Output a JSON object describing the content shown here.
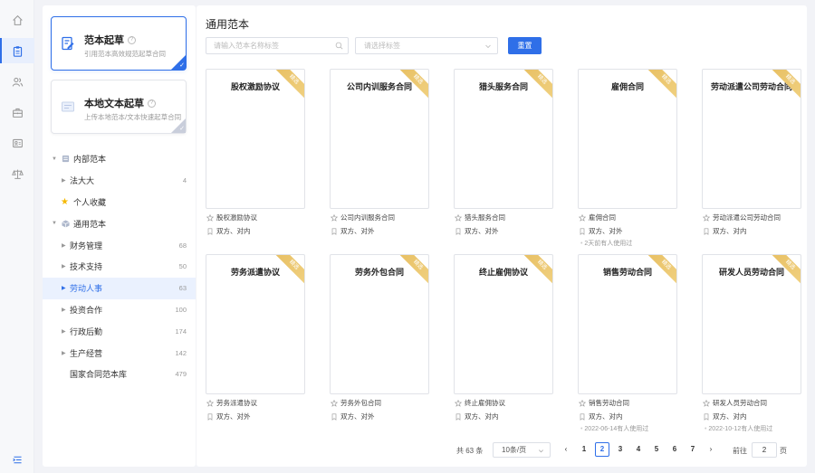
{
  "sidebar_rail": {
    "icons": [
      "home-icon",
      "clipboard-icon",
      "users-icon",
      "briefcase-icon",
      "id-card-icon",
      "scale-icon"
    ],
    "active_index": 1,
    "bottom_icon": "collapse-menu-icon"
  },
  "draft_cards": [
    {
      "title": "范本起草",
      "subtitle": "引用范本高效规范起草合同",
      "selected": true
    },
    {
      "title": "本地文本起草",
      "subtitle": "上传本地范本/文本快速起草合同",
      "selected": false
    }
  ],
  "tree": [
    {
      "label": "内部范本",
      "count": "",
      "level": 0,
      "expanded": true,
      "icon": "folder-icon"
    },
    {
      "label": "法大大",
      "count": "4",
      "level": 1,
      "expanded": false
    },
    {
      "label": "个人收藏",
      "count": "",
      "level": 1,
      "icon": "star-icon"
    },
    {
      "label": "通用范本",
      "count": "",
      "level": 0,
      "expanded": true,
      "icon": "cube-icon"
    },
    {
      "label": "财务管理",
      "count": "68",
      "level": 1,
      "expanded": false
    },
    {
      "label": "技术支持",
      "count": "50",
      "level": 1,
      "expanded": false
    },
    {
      "label": "劳动人事",
      "count": "63",
      "level": 1,
      "expanded": false,
      "active": true
    },
    {
      "label": "投资合作",
      "count": "100",
      "level": 1,
      "expanded": false
    },
    {
      "label": "行政后勤",
      "count": "174",
      "level": 1,
      "expanded": false
    },
    {
      "label": "生产经营",
      "count": "142",
      "level": 1,
      "expanded": false
    },
    {
      "label": "国家合同范本库",
      "count": "479",
      "level": 1,
      "noarrow": true
    }
  ],
  "main": {
    "title": "通用范本",
    "search_placeholder": "请输入范本名称标签",
    "tag_placeholder": "请选择标签",
    "reset_label": "重置",
    "ribbon_label": "精选"
  },
  "templates": [
    {
      "name": "股权激励协议",
      "parties": "双方、对内",
      "used": ""
    },
    {
      "name": "公司内训服务合同",
      "parties": "双方、对外",
      "used": ""
    },
    {
      "name": "猎头服务合同",
      "parties": "双方、对外",
      "used": ""
    },
    {
      "name": "雇佣合同",
      "parties": "双方、对外",
      "used": "2天前有人使用过"
    },
    {
      "name": "劳动派遣公司劳动合同",
      "parties": "双方、对内",
      "used": ""
    },
    {
      "name": "劳务派遣协议",
      "parties": "双方、对外",
      "used": ""
    },
    {
      "name": "劳务外包合同",
      "parties": "双方、对外",
      "used": ""
    },
    {
      "name": "终止雇佣协议",
      "parties": "双方、对内",
      "used": ""
    },
    {
      "name": "销售劳动合同",
      "parties": "双方、对内",
      "used": "2022-06-14有人使用过"
    },
    {
      "name": "研发人员劳动合同",
      "parties": "双方、对内",
      "used": "2022-10-12有人使用过"
    }
  ],
  "pagination": {
    "total_label": "共 63 条",
    "page_size": "10条/页",
    "pages": [
      "1",
      "2",
      "3",
      "4",
      "5",
      "6",
      "7"
    ],
    "current": "2",
    "goto_prefix": "前往",
    "goto_value": "2",
    "goto_suffix": "页"
  },
  "colors": {
    "accent": "#2f6fe8",
    "ribbon": "#e7be60"
  }
}
